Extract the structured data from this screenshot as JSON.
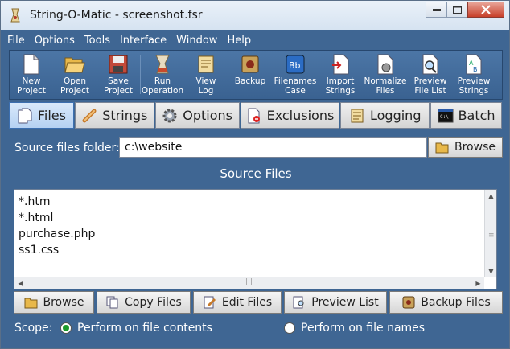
{
  "window": {
    "title": "String-O-Matic - screenshot.fsr"
  },
  "menu": [
    "File",
    "Options",
    "Tools",
    "Interface",
    "Window",
    "Help"
  ],
  "toolbar": [
    {
      "label": "New\nProject",
      "icon": "new-project-icon"
    },
    {
      "label": "Open\nProject",
      "icon": "open-project-icon"
    },
    {
      "label": "Save\nProject",
      "icon": "save-project-icon"
    },
    {
      "label": "Run\nOperation",
      "icon": "run-operation-icon"
    },
    {
      "label": "View\nLog",
      "icon": "view-log-icon"
    },
    {
      "label": "Backup",
      "icon": "backup-icon"
    },
    {
      "label": "Filenames\nCase",
      "icon": "filenames-case-icon"
    },
    {
      "label": "Import\nStrings",
      "icon": "import-strings-icon"
    },
    {
      "label": "Normalize\nFiles",
      "icon": "normalize-files-icon"
    },
    {
      "label": "Preview\nFile List",
      "icon": "preview-file-list-icon"
    },
    {
      "label": "Preview\nStrings",
      "icon": "preview-strings-icon"
    }
  ],
  "tabs": [
    {
      "label": "Files",
      "active": true
    },
    {
      "label": "Strings",
      "active": false
    },
    {
      "label": "Options",
      "active": false
    },
    {
      "label": "Exclusions",
      "active": false
    },
    {
      "label": "Logging",
      "active": false
    },
    {
      "label": "Batch",
      "active": false
    }
  ],
  "source": {
    "label": "Source files folder:",
    "value": "c:\\website",
    "browse_label": "Browse",
    "heading": "Source Files"
  },
  "files": [
    "*.htm",
    "*.html",
    "purchase.php",
    "ss1.css"
  ],
  "actions": [
    "Browse",
    "Copy Files",
    "Edit Files",
    "Preview List",
    "Backup Files"
  ],
  "scope": {
    "label": "Scope:",
    "option_contents": "Perform on file contents",
    "option_names": "Perform on file names",
    "selected": "contents"
  }
}
